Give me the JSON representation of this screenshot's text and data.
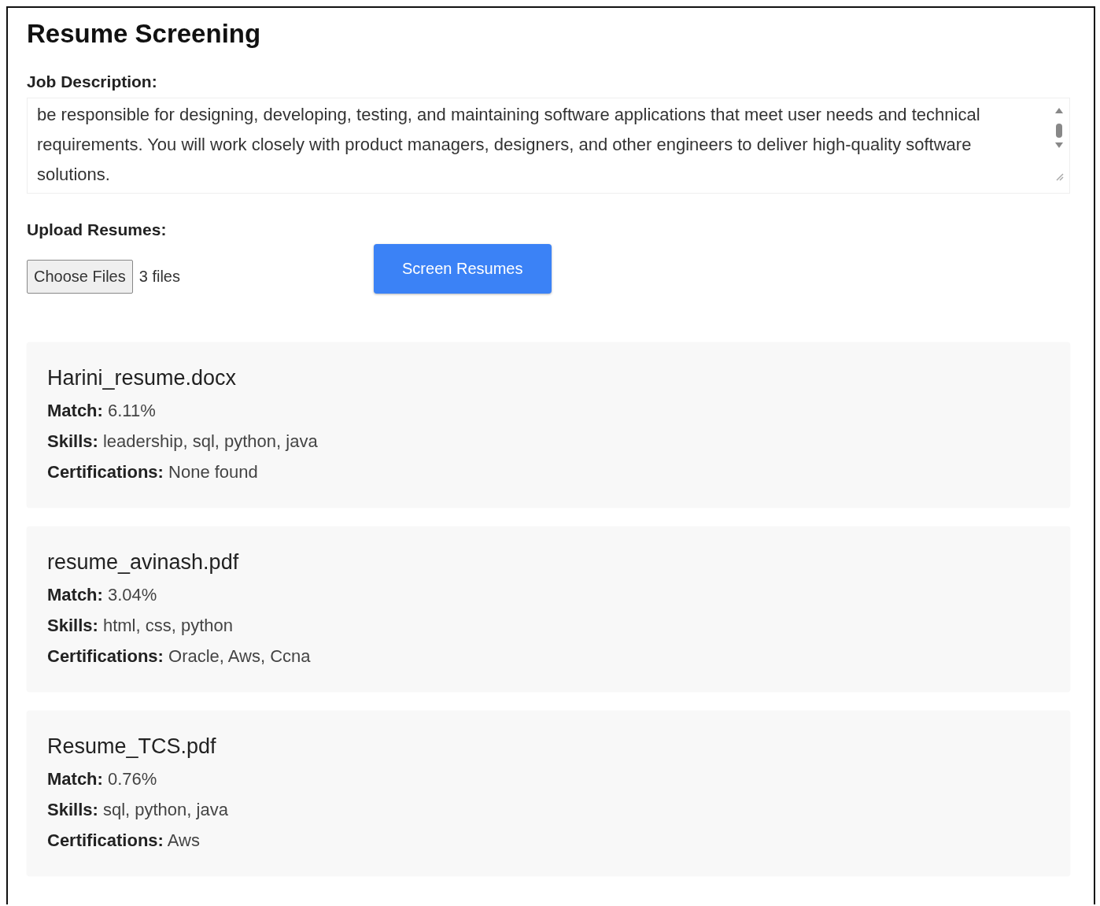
{
  "title": "Resume Screening",
  "job_description": {
    "label": "Job Description:",
    "value": "be responsible for designing, developing, testing, and maintaining software applications that meet user needs and technical requirements. You will work closely with product managers, designers, and other engineers to deliver high-quality software solutions."
  },
  "upload": {
    "label": "Upload Resumes:",
    "button": "Choose Files",
    "status": "3 files"
  },
  "submit_button": "Screen Resumes",
  "results": [
    {
      "filename": "Harini_resume.docx",
      "lines": [
        "**Match:** 6.11%",
        "**Skills:** leadership, sql, python, java",
        "**Certifications:** None found"
      ]
    },
    {
      "filename": "resume_avinash.pdf",
      "lines": [
        "**Match:** 3.04%",
        "**Skills:** html, css, python",
        "**Certifications:** Oracle, Aws, Ccna"
      ]
    },
    {
      "filename": "Resume_TCS.pdf",
      "lines": [
        "**Match:** 0.76%",
        "**Skills:** sql, python, java",
        "**Certifications:** Aws"
      ]
    }
  ]
}
